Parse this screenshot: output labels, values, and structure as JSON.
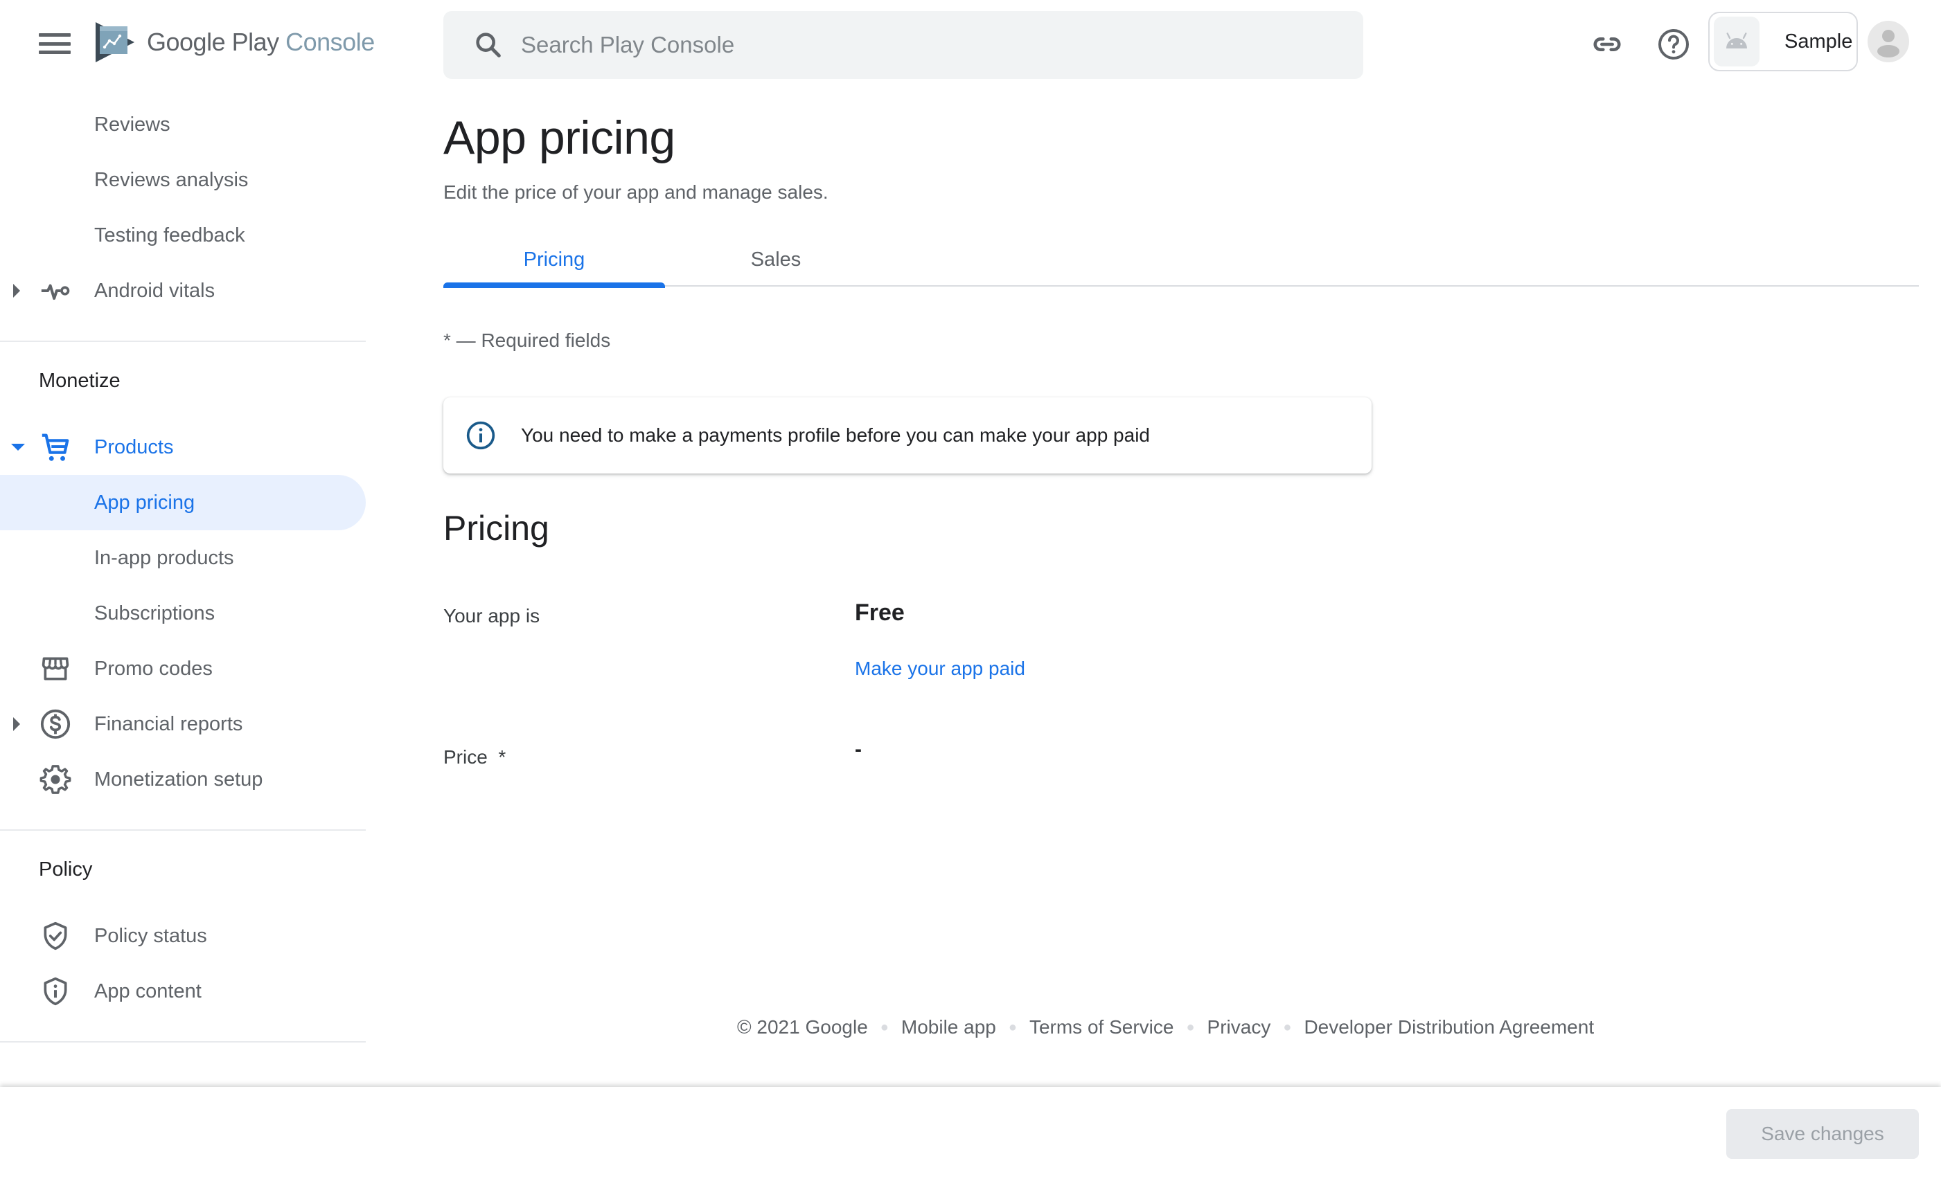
{
  "header": {
    "logo_text_primary": "Google Play",
    "logo_text_secondary": "Console",
    "search_placeholder": "Search Play Console",
    "icons": [
      "menu-icon",
      "link-icon",
      "help-icon",
      "android-icon",
      "account-avatar-icon"
    ],
    "app_name": "Sample"
  },
  "sidebar": {
    "items_top": [
      {
        "label": "Reviews",
        "icon": null
      },
      {
        "label": "Reviews analysis",
        "icon": null
      },
      {
        "label": "Testing feedback",
        "icon": null
      },
      {
        "label": "Android vitals",
        "icon": "vitals-icon",
        "expandable": true
      }
    ],
    "sections": [
      {
        "title": "Monetize",
        "items": [
          {
            "label": "Products",
            "icon": "cart-icon",
            "expanded": true,
            "active": true
          },
          {
            "label": "App pricing",
            "selected": true
          },
          {
            "label": "In-app products"
          },
          {
            "label": "Subscriptions"
          },
          {
            "label": "Promo codes",
            "icon": "storefront-icon"
          },
          {
            "label": "Financial reports",
            "icon": "dollar-icon",
            "expandable": true
          },
          {
            "label": "Monetization setup",
            "icon": "gear-icon"
          }
        ]
      },
      {
        "title": "Policy",
        "items": [
          {
            "label": "Policy status",
            "icon": "shield-check-icon"
          },
          {
            "label": "App content",
            "icon": "shield-info-icon"
          }
        ]
      }
    ]
  },
  "main": {
    "title": "App pricing",
    "subtitle": "Edit the price of your app and manage sales.",
    "tabs": [
      {
        "label": "Pricing",
        "active": true
      },
      {
        "label": "Sales",
        "active": false
      }
    ],
    "required_note": "* — Required fields",
    "info_banner": "You need to make a payments profile before you can make your app paid",
    "section_title": "Pricing",
    "fields": {
      "app_is_label": "Your app is",
      "app_is_value": "Free",
      "make_paid_link": "Make your app paid",
      "price_label": "Price  *",
      "price_value": "-"
    }
  },
  "footer": {
    "copyright": "© 2021 Google",
    "links": [
      "Mobile app",
      "Terms of Service",
      "Privacy",
      "Developer Distribution Agreement"
    ]
  },
  "actions": {
    "save_label": "Save changes",
    "save_enabled": false
  },
  "colors": {
    "accent": "#1a73e8",
    "selected_bg": "#e8f0fe",
    "text_secondary": "#5f6368",
    "info_icon": "#1a5a8a"
  }
}
